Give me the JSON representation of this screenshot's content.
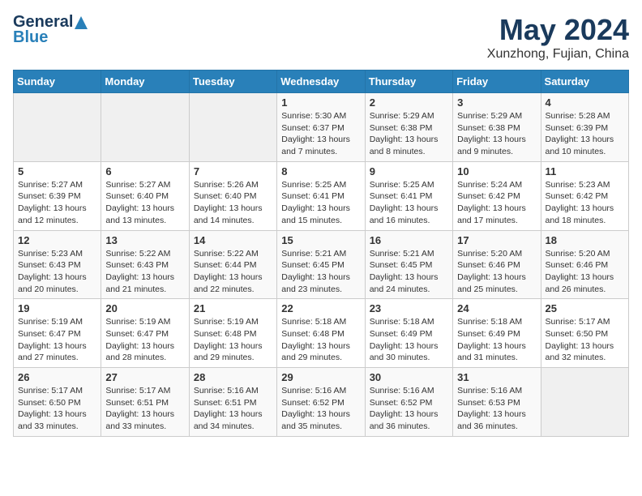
{
  "header": {
    "logo_general": "General",
    "logo_blue": "Blue",
    "month_title": "May 2024",
    "location": "Xunzhong, Fujian, China"
  },
  "weekdays": [
    "Sunday",
    "Monday",
    "Tuesday",
    "Wednesday",
    "Thursday",
    "Friday",
    "Saturday"
  ],
  "weeks": [
    [
      {
        "day": "",
        "info": ""
      },
      {
        "day": "",
        "info": ""
      },
      {
        "day": "",
        "info": ""
      },
      {
        "day": "1",
        "info": "Sunrise: 5:30 AM\nSunset: 6:37 PM\nDaylight: 13 hours\nand 7 minutes."
      },
      {
        "day": "2",
        "info": "Sunrise: 5:29 AM\nSunset: 6:38 PM\nDaylight: 13 hours\nand 8 minutes."
      },
      {
        "day": "3",
        "info": "Sunrise: 5:29 AM\nSunset: 6:38 PM\nDaylight: 13 hours\nand 9 minutes."
      },
      {
        "day": "4",
        "info": "Sunrise: 5:28 AM\nSunset: 6:39 PM\nDaylight: 13 hours\nand 10 minutes."
      }
    ],
    [
      {
        "day": "5",
        "info": "Sunrise: 5:27 AM\nSunset: 6:39 PM\nDaylight: 13 hours\nand 12 minutes."
      },
      {
        "day": "6",
        "info": "Sunrise: 5:27 AM\nSunset: 6:40 PM\nDaylight: 13 hours\nand 13 minutes."
      },
      {
        "day": "7",
        "info": "Sunrise: 5:26 AM\nSunset: 6:40 PM\nDaylight: 13 hours\nand 14 minutes."
      },
      {
        "day": "8",
        "info": "Sunrise: 5:25 AM\nSunset: 6:41 PM\nDaylight: 13 hours\nand 15 minutes."
      },
      {
        "day": "9",
        "info": "Sunrise: 5:25 AM\nSunset: 6:41 PM\nDaylight: 13 hours\nand 16 minutes."
      },
      {
        "day": "10",
        "info": "Sunrise: 5:24 AM\nSunset: 6:42 PM\nDaylight: 13 hours\nand 17 minutes."
      },
      {
        "day": "11",
        "info": "Sunrise: 5:23 AM\nSunset: 6:42 PM\nDaylight: 13 hours\nand 18 minutes."
      }
    ],
    [
      {
        "day": "12",
        "info": "Sunrise: 5:23 AM\nSunset: 6:43 PM\nDaylight: 13 hours\nand 20 minutes."
      },
      {
        "day": "13",
        "info": "Sunrise: 5:22 AM\nSunset: 6:43 PM\nDaylight: 13 hours\nand 21 minutes."
      },
      {
        "day": "14",
        "info": "Sunrise: 5:22 AM\nSunset: 6:44 PM\nDaylight: 13 hours\nand 22 minutes."
      },
      {
        "day": "15",
        "info": "Sunrise: 5:21 AM\nSunset: 6:45 PM\nDaylight: 13 hours\nand 23 minutes."
      },
      {
        "day": "16",
        "info": "Sunrise: 5:21 AM\nSunset: 6:45 PM\nDaylight: 13 hours\nand 24 minutes."
      },
      {
        "day": "17",
        "info": "Sunrise: 5:20 AM\nSunset: 6:46 PM\nDaylight: 13 hours\nand 25 minutes."
      },
      {
        "day": "18",
        "info": "Sunrise: 5:20 AM\nSunset: 6:46 PM\nDaylight: 13 hours\nand 26 minutes."
      }
    ],
    [
      {
        "day": "19",
        "info": "Sunrise: 5:19 AM\nSunset: 6:47 PM\nDaylight: 13 hours\nand 27 minutes."
      },
      {
        "day": "20",
        "info": "Sunrise: 5:19 AM\nSunset: 6:47 PM\nDaylight: 13 hours\nand 28 minutes."
      },
      {
        "day": "21",
        "info": "Sunrise: 5:19 AM\nSunset: 6:48 PM\nDaylight: 13 hours\nand 29 minutes."
      },
      {
        "day": "22",
        "info": "Sunrise: 5:18 AM\nSunset: 6:48 PM\nDaylight: 13 hours\nand 29 minutes."
      },
      {
        "day": "23",
        "info": "Sunrise: 5:18 AM\nSunset: 6:49 PM\nDaylight: 13 hours\nand 30 minutes."
      },
      {
        "day": "24",
        "info": "Sunrise: 5:18 AM\nSunset: 6:49 PM\nDaylight: 13 hours\nand 31 minutes."
      },
      {
        "day": "25",
        "info": "Sunrise: 5:17 AM\nSunset: 6:50 PM\nDaylight: 13 hours\nand 32 minutes."
      }
    ],
    [
      {
        "day": "26",
        "info": "Sunrise: 5:17 AM\nSunset: 6:50 PM\nDaylight: 13 hours\nand 33 minutes."
      },
      {
        "day": "27",
        "info": "Sunrise: 5:17 AM\nSunset: 6:51 PM\nDaylight: 13 hours\nand 33 minutes."
      },
      {
        "day": "28",
        "info": "Sunrise: 5:16 AM\nSunset: 6:51 PM\nDaylight: 13 hours\nand 34 minutes."
      },
      {
        "day": "29",
        "info": "Sunrise: 5:16 AM\nSunset: 6:52 PM\nDaylight: 13 hours\nand 35 minutes."
      },
      {
        "day": "30",
        "info": "Sunrise: 5:16 AM\nSunset: 6:52 PM\nDaylight: 13 hours\nand 36 minutes."
      },
      {
        "day": "31",
        "info": "Sunrise: 5:16 AM\nSunset: 6:53 PM\nDaylight: 13 hours\nand 36 minutes."
      },
      {
        "day": "",
        "info": ""
      }
    ]
  ]
}
